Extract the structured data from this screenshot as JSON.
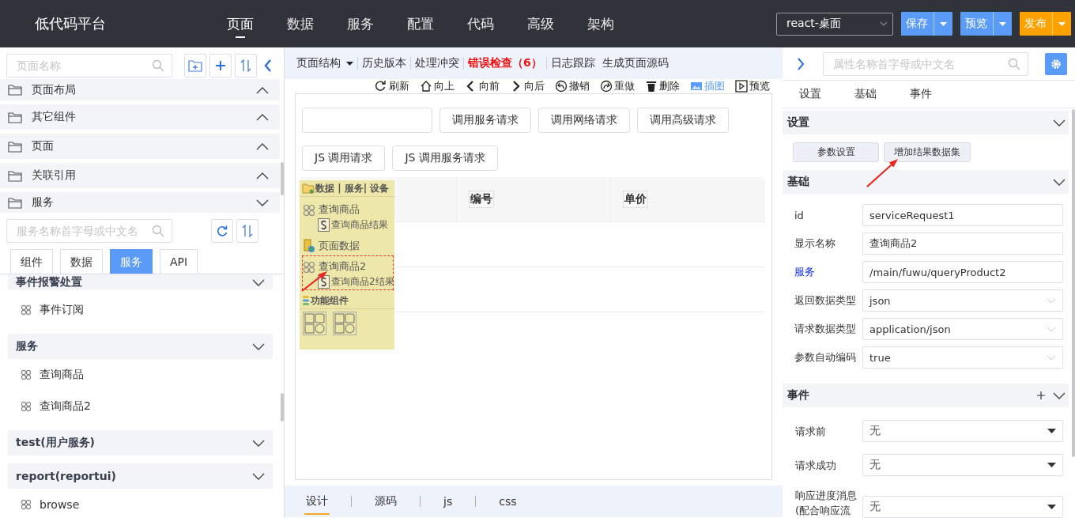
{
  "app": {
    "title": "低代码平台"
  },
  "nav": [
    {
      "label": "页面",
      "selected": true
    },
    {
      "label": "数据",
      "selected": false
    },
    {
      "label": "服务",
      "selected": false
    },
    {
      "label": "配置",
      "selected": false
    },
    {
      "label": "代码",
      "selected": false
    },
    {
      "label": "高级",
      "selected": false
    },
    {
      "label": "架构",
      "selected": false
    }
  ],
  "header_controls": {
    "platform_select": "react-桌面",
    "buttons": [
      {
        "label": "保存",
        "color": "#5b9bf8"
      },
      {
        "label": "预览",
        "color": "#5b9bf8"
      },
      {
        "label": "发布",
        "color": "#ffa200"
      }
    ]
  },
  "left": {
    "search": {
      "placeholder": "页面名称"
    },
    "sections": [
      {
        "label": "页面布局",
        "expanded": false
      },
      {
        "label": "其它组件",
        "expanded": false
      },
      {
        "label": "页面",
        "expanded": false
      },
      {
        "label": "关联引用",
        "expanded": false
      },
      {
        "label": "服务",
        "expanded": true
      }
    ],
    "service_search": {
      "placeholder": "服务名称首字母或中文名"
    },
    "tabs": [
      {
        "label": "组件",
        "selected": false
      },
      {
        "label": "数据",
        "selected": false
      },
      {
        "label": "服务",
        "selected": true
      },
      {
        "label": "API",
        "selected": false
      }
    ],
    "groups": [
      {
        "label": "事件报警处置",
        "items": [
          "事件订阅"
        ]
      },
      {
        "label": "服务",
        "items": [
          "查询商品",
          "查询商品2"
        ]
      },
      {
        "label": "test(用户服务)"
      },
      {
        "label": "report(reportui)",
        "items": [
          "browse"
        ]
      }
    ]
  },
  "center": {
    "menu": [
      {
        "label": "页面结构",
        "kind": "dropdown"
      },
      {
        "label": "历史版本",
        "kind": "plain"
      },
      {
        "label": "处理冲突",
        "kind": "plain"
      },
      {
        "label": "错误检查（6）",
        "kind": "error"
      },
      {
        "label": "日志跟踪",
        "kind": "plain"
      },
      {
        "label": "生成页面源码",
        "kind": "plain"
      }
    ],
    "toolbar": [
      {
        "label": "刷新",
        "kind": "refresh",
        "selected": false
      },
      {
        "label": "向上",
        "kind": "up",
        "selected": false
      },
      {
        "label": "向前",
        "kind": "back",
        "selected": false
      },
      {
        "label": "向后",
        "kind": "forward",
        "selected": false
      },
      {
        "label": "撤销",
        "kind": "undo",
        "selected": false
      },
      {
        "label": "重做",
        "kind": "redo",
        "selected": false
      },
      {
        "label": "删除",
        "kind": "delete",
        "selected": false
      },
      {
        "label": "插图",
        "kind": "image",
        "selected": true
      },
      {
        "label": "预览",
        "kind": "preview",
        "selected": false
      }
    ],
    "canvas": {
      "buttons": [
        "调用服务请求",
        "调用网络请求",
        "调用高级请求",
        "JS 调用请求",
        "JS 调用服务请求"
      ],
      "table": {
        "columns": [
          "编号",
          "单价"
        ]
      },
      "data_panel": {
        "title": "数据 | 服务| 设备",
        "items": [
          {
            "kind": "service",
            "label": "查询商品",
            "selected": false,
            "children": [
              {
                "kind": "dataset",
                "label": "查询商品结果"
              }
            ]
          },
          {
            "kind": "page-data",
            "label": "页面数据",
            "selected": false
          },
          {
            "kind": "service",
            "label": "查询商品2",
            "selected": true,
            "children": [
              {
                "kind": "dataset",
                "label": "查询商品2结果"
              }
            ]
          }
        ],
        "components_title": "功能组件"
      }
    },
    "bottom_tabs": [
      {
        "label": "设计",
        "selected": true
      },
      {
        "label": "源码",
        "selected": false
      },
      {
        "label": "js",
        "selected": false
      },
      {
        "label": "css",
        "selected": false
      }
    ]
  },
  "right": {
    "search": {
      "placeholder": "属性名称首字母或中文名"
    },
    "tabs": [
      "设置",
      "基础",
      "事件"
    ],
    "settings": {
      "title": "设置",
      "buttons": [
        "参数设置",
        "增加结果数据集"
      ]
    },
    "basic": {
      "title": "基础",
      "fields": [
        {
          "label": "id",
          "value": "serviceRequest1",
          "kind": "text",
          "link": false
        },
        {
          "label": "显示名称",
          "value": "查询商品2",
          "kind": "text",
          "link": false
        },
        {
          "label": "服务",
          "value": "/main/fuwu/queryProduct2",
          "kind": "text",
          "link": true
        },
        {
          "label": "返回数据类型",
          "value": "json",
          "kind": "select",
          "link": false
        },
        {
          "label": "请求数据类型",
          "value": "application/json",
          "kind": "select",
          "link": false
        },
        {
          "label": "参数自动编码",
          "value": "true",
          "kind": "select",
          "link": false
        }
      ]
    },
    "events": {
      "title": "事件",
      "fields": [
        {
          "label": "请求前",
          "value": "无"
        },
        {
          "label": "请求成功",
          "value": "无"
        },
        {
          "label": "响应进度消息(配合响应流",
          "value": "无"
        }
      ]
    }
  }
}
